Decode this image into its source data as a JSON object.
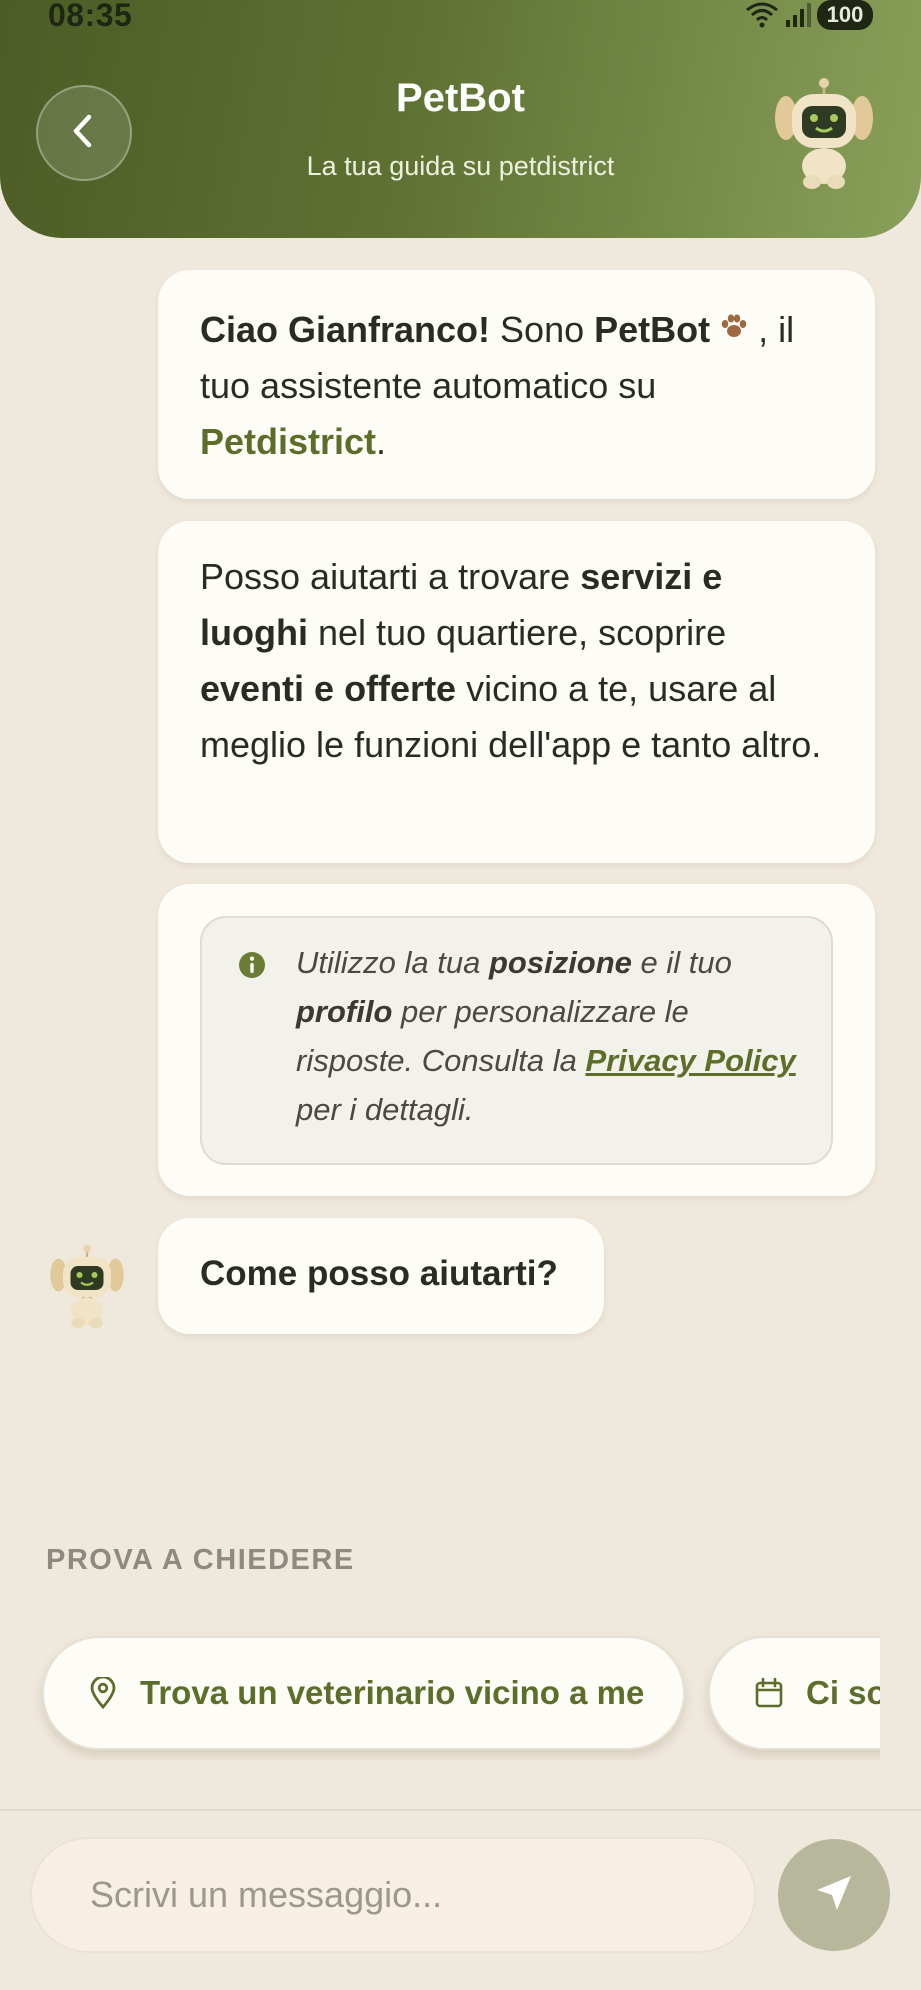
{
  "status_bar": {
    "time": "08:35",
    "battery": "100"
  },
  "header": {
    "title": "PetBot",
    "subtitle": "La tua guida su petdistrict"
  },
  "messages": {
    "greeting": {
      "hello": "Ciao Gianfranco!",
      "intro": " Sono ",
      "bot_name": "PetBot",
      "after_paw": " ,",
      "line2": " il tuo assistente automatico su ",
      "brand": "Petdistrict",
      "end": "."
    },
    "capabilities": {
      "p1": "Posso aiutarti a trovare ",
      "b1": "servizi e luoghi",
      "p2": " nel tuo quartiere, scoprire ",
      "b2": "eventi e offerte",
      "p3": " vicino a te, usare al meglio le funzioni dell'app e tanto altro."
    },
    "privacy": {
      "p1": "Utilizzo la tua ",
      "b1": "posizione",
      "p2": " e il tuo ",
      "b2": "profilo",
      "p3": " per personalizzare le risposte. Consulta la ",
      "link": "Privacy Policy",
      "p4": " per i dettagli."
    },
    "question": "Come posso aiutarti?"
  },
  "suggestions": {
    "label": "PROVA A CHIEDERE",
    "chips": [
      {
        "icon": "location-pin-icon",
        "label": "Trova un veterinario vicino a me"
      },
      {
        "icon": "calendar-icon",
        "label": "Ci sono eventi"
      }
    ]
  },
  "composer": {
    "placeholder": "Scrivi un messaggio...",
    "send_icon": "send-icon"
  },
  "colors": {
    "header_start": "#4c5c25",
    "header_end": "#89a05a",
    "brand_green": "#5d6e2a",
    "background": "#efe8dc",
    "bubble": "#fdfcf7",
    "send_button": "#b7b89b"
  }
}
